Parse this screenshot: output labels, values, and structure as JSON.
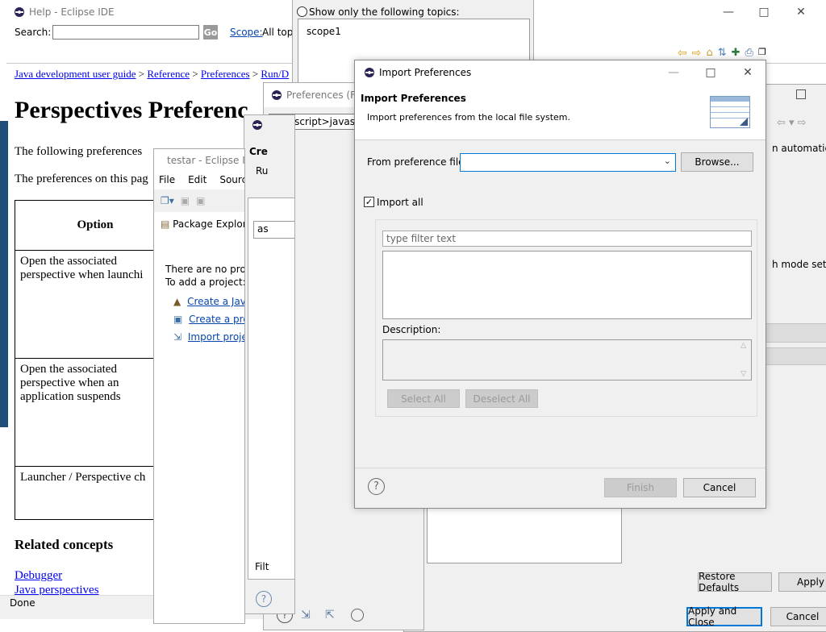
{
  "help_window": {
    "title": "Help - Eclipse IDE",
    "search_label": "Search:",
    "go_label": "Go",
    "scope_link": "Scope:",
    "scope_value": "All topi",
    "breadcrumb": [
      "Java development user guide",
      "Reference",
      "Preferences",
      "Run/D"
    ],
    "page_heading": "Perspectives Preferenc",
    "para1": "The following preferences",
    "para2": "The preferences on this pag",
    "table_header": "Option",
    "rows": [
      "Open the associated perspective when launchi",
      "Open the associated perspective when an application suspends",
      "Launcher / Perspective ch"
    ],
    "related_heading": "Related concepts",
    "related_links": [
      "Debugger",
      "Java perspectives"
    ],
    "status": "Done"
  },
  "scope_dialog": {
    "radio_label": "Show only the following topics:",
    "tree_item": "scope1"
  },
  "testar_window": {
    "title": "testar - Eclipse I",
    "menu": [
      "File",
      "Edit",
      "Source"
    ],
    "view_title": "Package Explore",
    "no_projects": "There are no projec",
    "to_add": "To add a project:",
    "links": [
      "Create a Java",
      "Create a proj",
      "Import proje"
    ]
  },
  "prefs_filter_window": {
    "title": "Preferences (Filt",
    "filter_text": "javascript>javascrip"
  },
  "create_window": {
    "title": "Cre",
    "sub": "Ru",
    "field_text": "as",
    "filter_label": "Filt"
  },
  "prefs_window": {
    "text1": "n automatically",
    "text2": "h mode set. Se",
    "restore_label": "Restore Defaults",
    "apply_label": "Apply",
    "apply_close_label": "Apply and Close",
    "cancel_label": "Cancel"
  },
  "import_dialog": {
    "title": "Import Preferences",
    "header_title": "Import Preferences",
    "header_desc": "Import preferences from the local file system.",
    "from_label": "From preference file:",
    "from_value": "",
    "browse_label": "Browse...",
    "import_all_label": "Import all",
    "import_all_checked": true,
    "filter_placeholder": "type filter text",
    "description_label": "Description:",
    "select_all_label": "Select All",
    "deselect_all_label": "Deselect All",
    "finish_label": "Finish",
    "cancel_label": "Cancel"
  },
  "colors": {
    "accent": "#0078d7",
    "link": "#0000ee",
    "dialog_bg": "#f0f0f0",
    "disabled_text": "#9a9a9a"
  }
}
